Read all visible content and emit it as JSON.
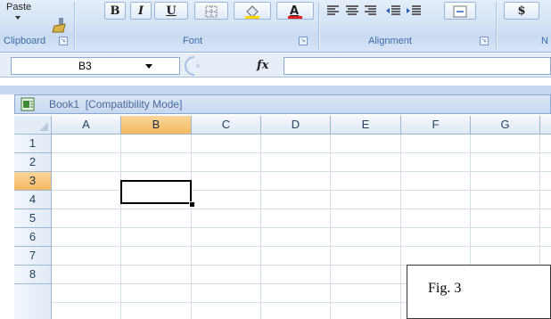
{
  "ribbon": {
    "paste_label": "Paste",
    "clipboard_label": "Clipboard",
    "font_label": "Font",
    "alignment_label": "Alignment",
    "number_label_partial": "N",
    "bold_label": "B",
    "italic_label": "I",
    "underline_label": "U",
    "currency_label": "$",
    "icons": [
      "paste-brush-icon",
      "borders-icon",
      "fill-color-icon",
      "font-color-icon",
      "align-left-icon",
      "align-center-icon",
      "align-right-icon",
      "decrease-indent-icon",
      "increase-indent-icon",
      "merge-center-icon",
      "dialog-launcher-icon"
    ],
    "font_color_accent": "#e02020",
    "fill_color_accent": "#ffd700"
  },
  "formula_bar": {
    "name_box_value": "B3",
    "fx_label": "fx",
    "formula_value": ""
  },
  "workbook": {
    "title": "Book1  [Compatibility Mode]"
  },
  "grid": {
    "columns": [
      "A",
      "B",
      "C",
      "D",
      "E",
      "F",
      "G"
    ],
    "rows": [
      "1",
      "2",
      "3",
      "4",
      "5",
      "6",
      "7",
      "8"
    ],
    "selected_cell": "B3",
    "selection_color": "#f4b860"
  },
  "figure": {
    "label": "Fig. 3"
  }
}
